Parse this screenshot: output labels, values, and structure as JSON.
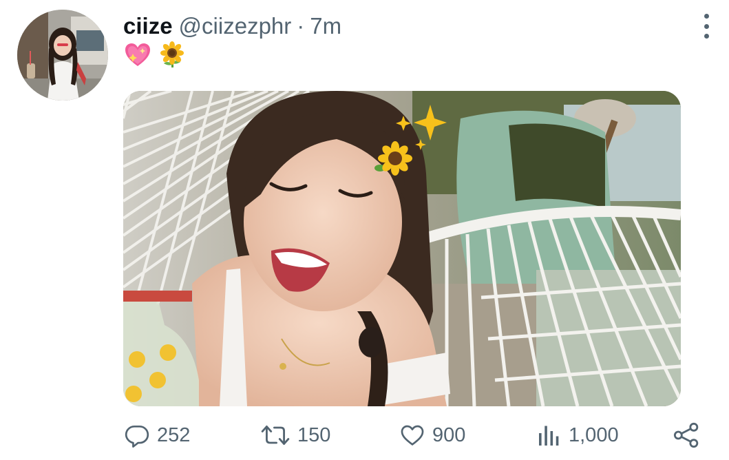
{
  "tweet": {
    "display_name": "ciize",
    "handle": "@ciizezphr",
    "separator": "·",
    "time": "7m",
    "text_emojis": [
      "sparkling-heart-emoji",
      "sunflower-emoji"
    ]
  },
  "media": {
    "alt_icons": [
      "sunflower-emoji",
      "sparkles-emoji"
    ]
  },
  "actions": {
    "replies": "252",
    "retweets": "150",
    "likes": "900",
    "views": "1,000"
  },
  "colors": {
    "text_primary": "#0f1419",
    "text_secondary": "#536471",
    "background": "#ffffff"
  }
}
